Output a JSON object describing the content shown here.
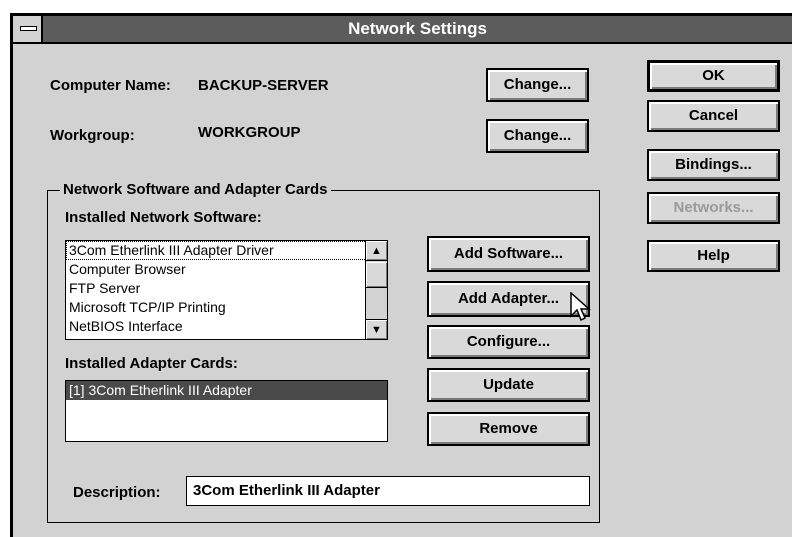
{
  "window": {
    "title": "Network Settings"
  },
  "computer_name": {
    "label": "Computer Name:",
    "value": "BACKUP-SERVER",
    "change_label": "Change..."
  },
  "workgroup": {
    "label": "Workgroup:",
    "value": "WORKGROUP",
    "change_label": "Change..."
  },
  "side_buttons": {
    "ok": "OK",
    "cancel": "Cancel",
    "bindings": "Bindings...",
    "networks": "Networks...",
    "help": "Help"
  },
  "group": {
    "title": "Network Software and Adapter Cards",
    "software_label": "Installed Network Software:",
    "software_items": [
      "3Com Etherlink III Adapter Driver",
      "Computer Browser",
      "FTP Server",
      "Microsoft TCP/IP Printing",
      "NetBIOS Interface"
    ],
    "adapter_label": "Installed Adapter Cards:",
    "adapter_items": [
      "[1] 3Com Etherlink III Adapter"
    ],
    "buttons": {
      "add_software": "Add Software...",
      "add_adapter": "Add Adapter...",
      "configure": "Configure...",
      "update": "Update",
      "remove": "Remove"
    },
    "description_label": "Description:",
    "description_value": "3Com Etherlink III Adapter"
  }
}
